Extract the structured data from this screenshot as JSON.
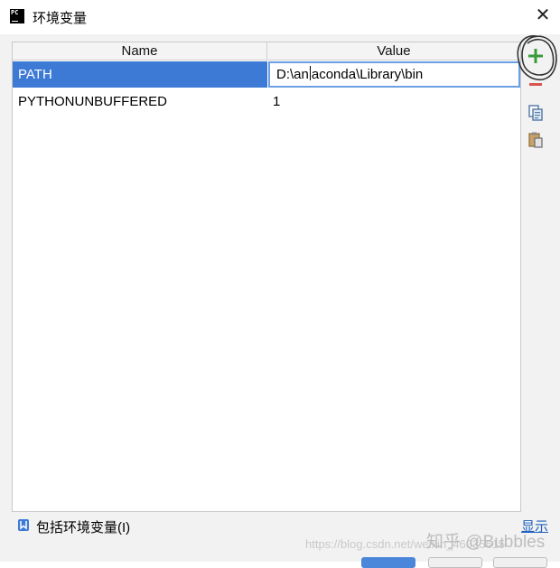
{
  "window": {
    "title": "环境变量",
    "close_glyph": "✕"
  },
  "table": {
    "columns": {
      "name": "Name",
      "value": "Value"
    },
    "rows": [
      {
        "name": "PATH",
        "value_before_caret": "D:\\an",
        "value_after_caret": "aconda\\Library\\bin",
        "selected": true,
        "editing": true
      },
      {
        "name": "PYTHONUNBUFFERED",
        "value": "1",
        "selected": false
      }
    ]
  },
  "toolbar": {
    "icons": [
      "add-icon",
      "remove-icon",
      "copy-icon",
      "paste-icon"
    ],
    "colors": {
      "add": "#3a9a3a",
      "remove": "#d9534f",
      "selection": "#3d7ad6"
    }
  },
  "footer": {
    "include_label": "包括环境变量(I)",
    "show_link": "显示"
  },
  "watermark": {
    "url": "https://blog.csdn.net/weixin_46035615",
    "zhihu": "知乎 @Bubbles"
  }
}
